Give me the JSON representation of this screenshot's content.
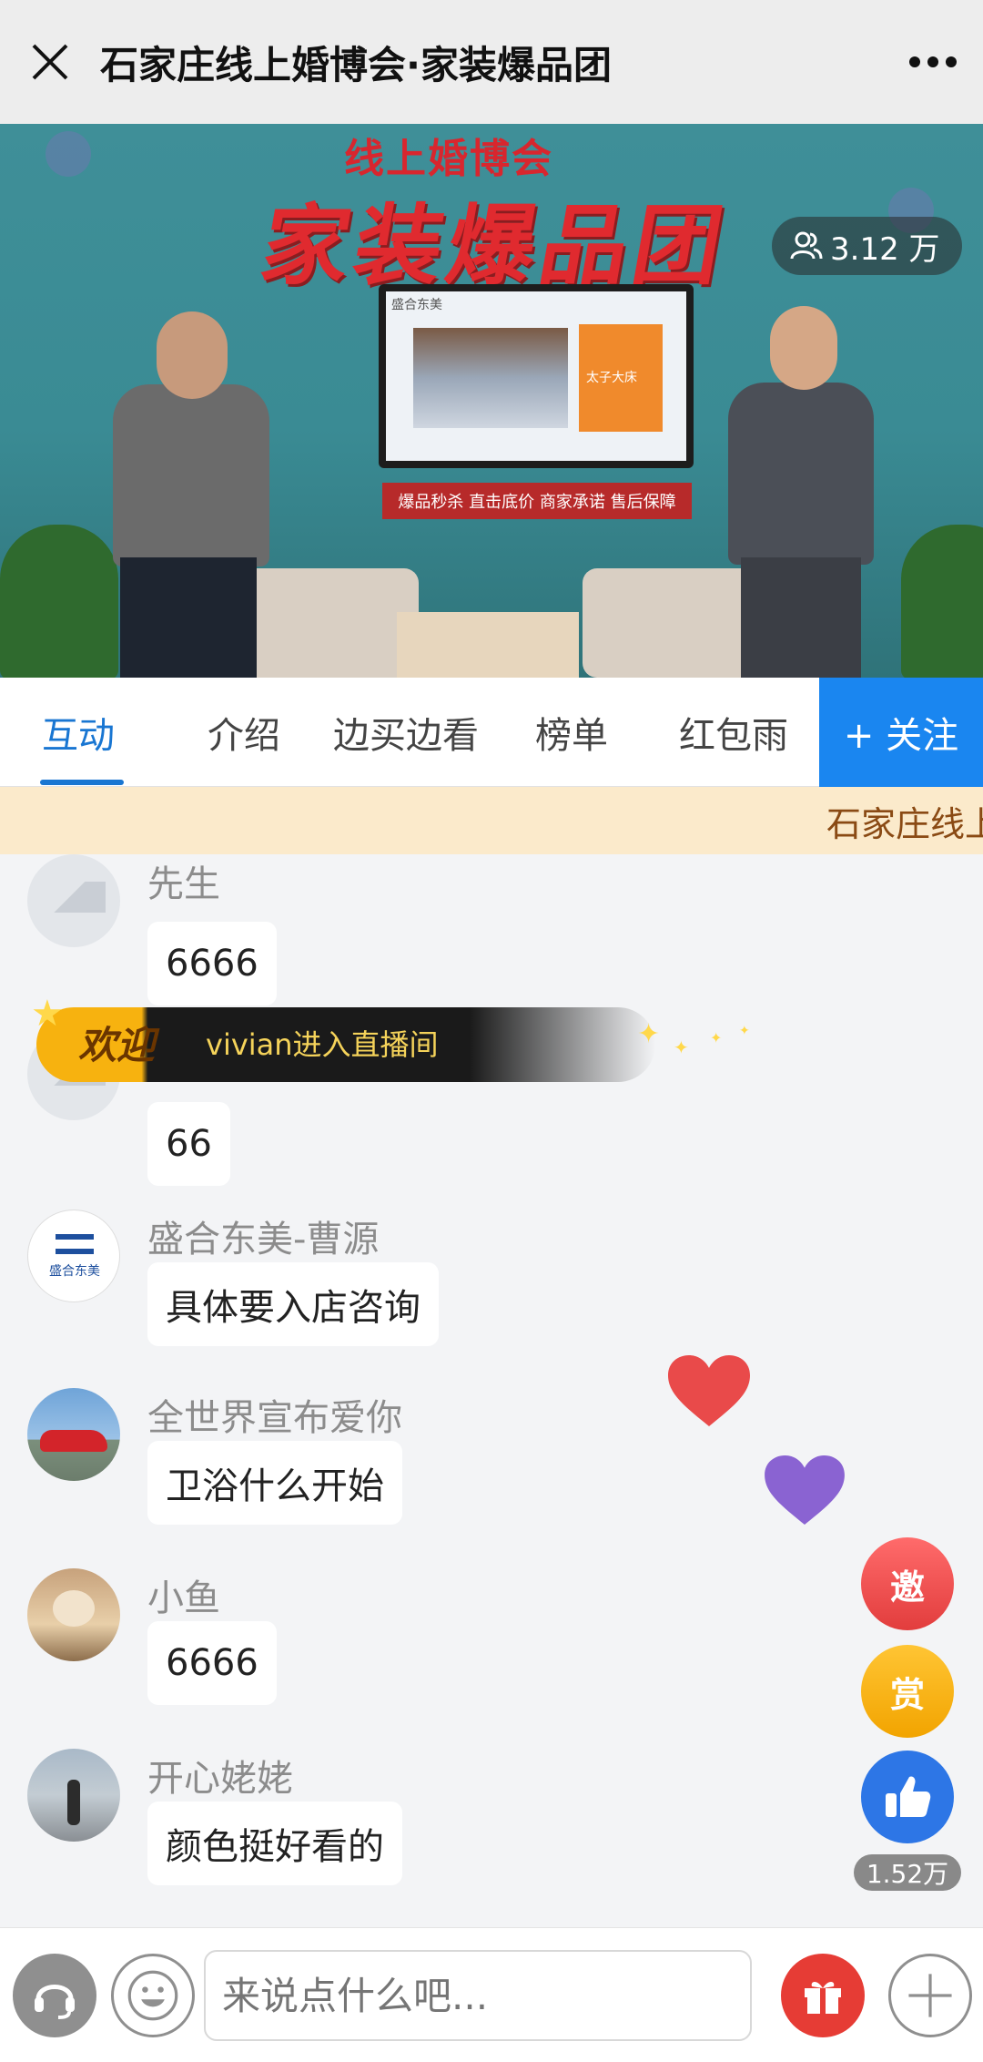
{
  "header": {
    "title": "石家庄线上婚博会·家装爆品团"
  },
  "video": {
    "brand_small": "线上婚博会",
    "brand_big": "家装爆品团",
    "viewers": "3.12 万",
    "tv_title": "盛合东美",
    "tv_tag": "太子大床",
    "slogan": "爆品秒杀 直击底价 商家承诺 售后保障"
  },
  "tabs": [
    {
      "label": "互动",
      "active": true
    },
    {
      "label": "介绍"
    },
    {
      "label": "边买边看"
    },
    {
      "label": "榜单"
    },
    {
      "label": "红包雨"
    }
  ],
  "follow_label": "+ 关注",
  "marquee_text": "石家庄线上婚博会",
  "welcome": {
    "badge": "欢迎",
    "text": "vivian进入直播间"
  },
  "messages": [
    {
      "name": "先生",
      "text": "6666",
      "avatar": "placeholder"
    },
    {
      "name": "",
      "text": "66",
      "avatar": "placeholder"
    },
    {
      "name": "盛合东美-曹源",
      "text": "具体要入店咨询",
      "avatar": "logo",
      "logo_text": "盛合东美"
    },
    {
      "name": "全世界宣布爱你",
      "text": "卫浴什么开始",
      "avatar": "car"
    },
    {
      "name": "小鱼",
      "text": "6666",
      "avatar": "cat"
    },
    {
      "name": "开心姥姥",
      "text": "颜色挺好看的",
      "avatar": "street"
    }
  ],
  "fab": {
    "invite": "邀",
    "reward": "赏",
    "like_count": "1.52万"
  },
  "input": {
    "placeholder": "来说点什么吧..."
  },
  "colors": {
    "accent": "#1976d2",
    "follow_bg": "#1a86f0",
    "heart_red": "#e94a4a",
    "heart_purple": "#8a63d2"
  },
  "icons": [
    "close-icon",
    "more-icon",
    "viewers-icon",
    "heart-icon",
    "thumbs-up-icon",
    "headset-icon",
    "emoji-icon",
    "gift-icon",
    "plus-icon"
  ]
}
